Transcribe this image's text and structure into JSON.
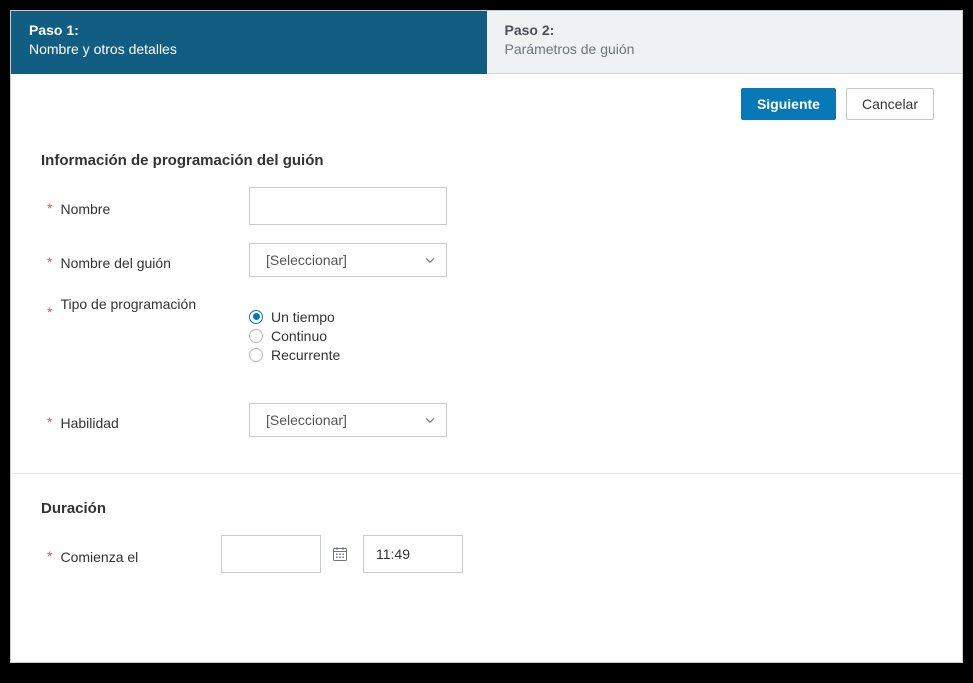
{
  "steps": {
    "step1": {
      "title": "Paso 1:",
      "subtitle": "Nombre y otros detalles"
    },
    "step2": {
      "title": "Paso 2:",
      "subtitle": "Parámetros de guión"
    }
  },
  "actions": {
    "next": "Siguiente",
    "cancel": "Cancelar"
  },
  "section1": {
    "heading": "Información de programación del guión",
    "name_label": "Nombre",
    "name_value": "",
    "script_name_label": "Nombre del guión",
    "script_name_selected": "[Seleccionar]",
    "sched_type_label": "Tipo de programación",
    "sched_options": {
      "one_time": "Un tiempo",
      "continuous": "Continuo",
      "recurring": "Recurrente"
    },
    "skill_label": "Habilidad",
    "skill_selected": "[Seleccionar]"
  },
  "section2": {
    "heading": "Duración",
    "start_label": "Comienza el",
    "date_value": "",
    "time_value": "11:49"
  }
}
